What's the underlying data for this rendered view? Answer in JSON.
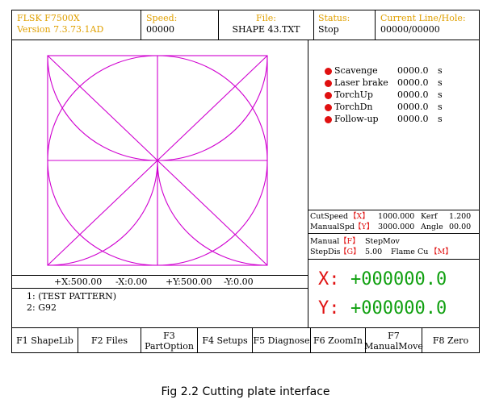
{
  "header": {
    "app_name": "FLSK F7500X",
    "version": "Version 7.3.73.1AD",
    "speed_label": "Speed:",
    "speed_value": "00000",
    "file_label": "File:",
    "file_value": "SHAPE 43.TXT",
    "status_label": "Status:",
    "status_value": "Stop",
    "line_label": "Current Line/Hole:",
    "line_value": "00000/00000"
  },
  "status_panel": [
    {
      "label": "Scavenge",
      "value": "0000.0",
      "unit": "s"
    },
    {
      "label": "Laser brake",
      "value": "0000.0",
      "unit": "s"
    },
    {
      "label": "TorchUp",
      "value": "0000.0",
      "unit": "s"
    },
    {
      "label": "TorchDn",
      "value": "0000.0",
      "unit": "s"
    },
    {
      "label": "Follow-up",
      "value": "0000.0",
      "unit": "s"
    }
  ],
  "params": {
    "cutspeed_label": "CutSpeed",
    "cutspeed_key": "【X】",
    "cutspeed_value": "1000.000",
    "kerf_label": "Kerf",
    "kerf_value": "1.200",
    "manualspd_label": "ManualSpd",
    "manualspd_key": "【Y】",
    "manualspd_value": "3000.000",
    "angle_label": "Angle",
    "angle_value": "00.00"
  },
  "mode": {
    "manual_label": "Manual",
    "manual_key": "【F】",
    "manual_value": "StepMov",
    "stepdis_label": "StepDis",
    "stepdis_key": "【G】",
    "stepdis_value": "5.00",
    "flame_label": "Flame Cu",
    "flame_key": "【M】"
  },
  "coords": {
    "xmax": "+X:500.00",
    "xmin": "-X:0.00",
    "ymax": "+Y:500.00",
    "ymin": "-Y:0.00"
  },
  "program": [
    "1: (TEST PATTERN)",
    "2: G92"
  ],
  "position": {
    "x_label": "X:",
    "x_value": "+000000.0",
    "y_label": "Y:",
    "y_value": "+000000.0"
  },
  "fkeys": [
    "F1 ShapeLib",
    "F2 Files",
    "F3\nPartOption",
    "F4 Setups",
    "F5 Diagnose",
    "F6 ZoomIn",
    "F7\nManualMove",
    "F8 Zero"
  ],
  "caption": "Fig 2.2 Cutting plate interface",
  "colors": {
    "label": "#e0a000",
    "shape": "#d000d0",
    "position": "#10a010",
    "indicator": "#e01010"
  }
}
